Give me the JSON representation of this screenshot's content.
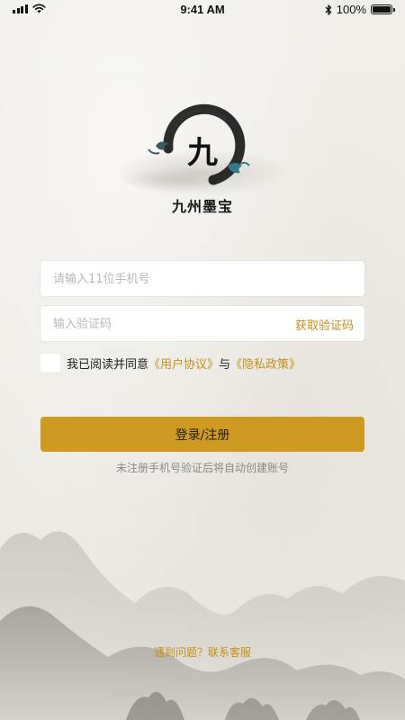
{
  "status_bar": {
    "time": "9:41 AM",
    "battery_text": "100%",
    "battery_level": 1.0
  },
  "brand": {
    "logo_char": "九",
    "name": "九州墨宝"
  },
  "login_form": {
    "phone_placeholder": "请输入11位手机号",
    "code_placeholder": "输入验证码",
    "get_code_label": "获取验证码",
    "agree_prefix": "我已阅读并同意",
    "user_agreement": "《用户协议》",
    "and_text": "与",
    "privacy_policy": "《隐私政策》",
    "submit_label": "登录/注册",
    "hint": "未注册手机号验证后将自动创建账号"
  },
  "footer": {
    "help_label": "遇到问题？联系客服"
  },
  "colors": {
    "accent": "#cf9a21",
    "link": "#c5901a",
    "background": "#efece6"
  },
  "icons": [
    "signal-icon",
    "wifi-icon",
    "bluetooth-icon",
    "battery-icon"
  ]
}
